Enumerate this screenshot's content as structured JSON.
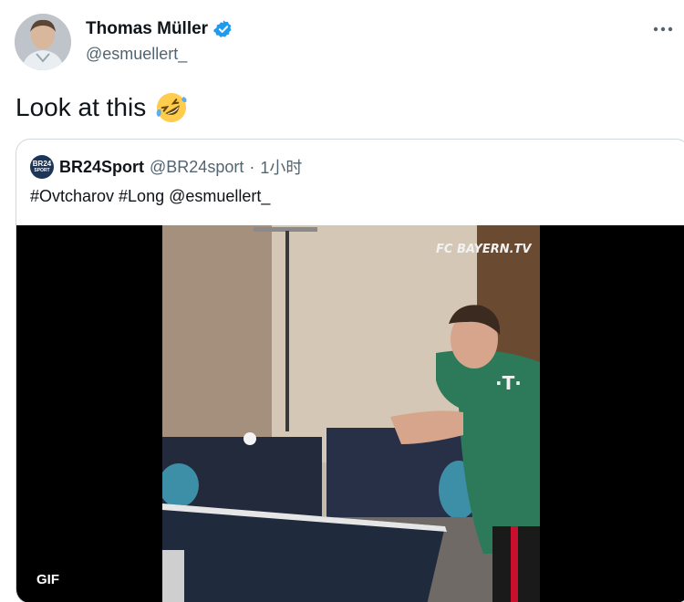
{
  "tweet": {
    "author_name": "Thomas Müller",
    "author_handle": "@esmuellert_",
    "text": "Look at this",
    "emoji": "rolling-on-floor-laughing"
  },
  "quote": {
    "avatar_text_top": "BR24",
    "avatar_text_bottom": "SPORT",
    "author_name": "BR24Sport",
    "author_handle": "@BR24sport",
    "separator": "·",
    "time": "1小时",
    "text": "#Ovtcharov #Long @esmuellert_",
    "media": {
      "watermark": "FC BAYERN.TV",
      "badge": "GIF"
    }
  },
  "colors": {
    "verified": "#1d9bf0",
    "jersey": "#2c7a5a",
    "secondary_text": "#536471"
  }
}
